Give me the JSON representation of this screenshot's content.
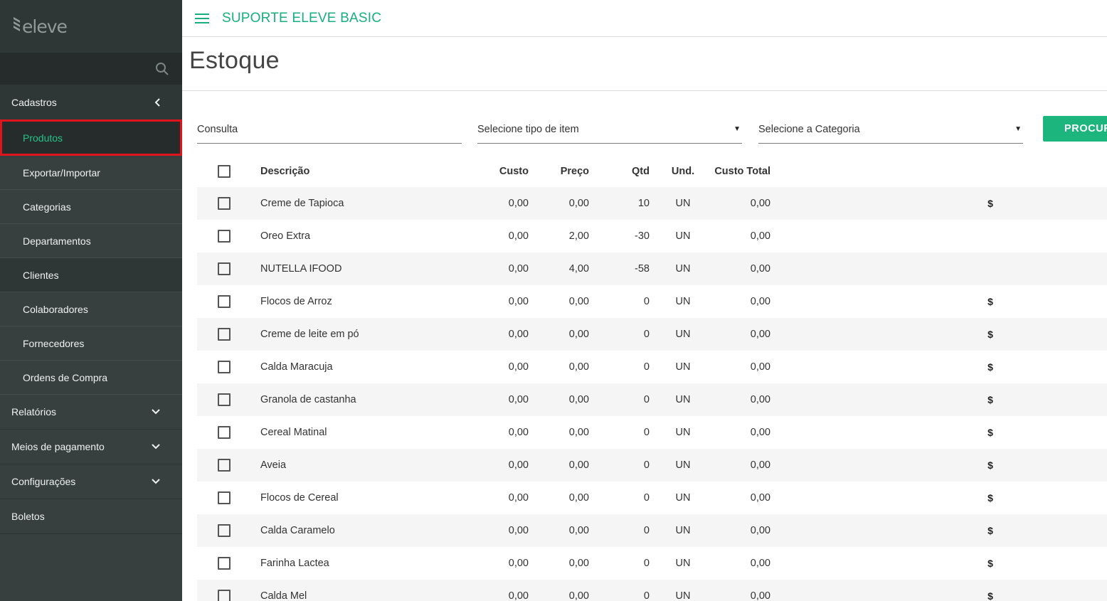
{
  "sidebar": {
    "logo_text": "eleve",
    "groups": {
      "cadastros": "Cadastros",
      "relatorios": "Relatórios",
      "meios": "Meios de pagamento",
      "config": "Configurações",
      "boletos": "Boletos"
    },
    "items": {
      "produtos": "Produtos",
      "exportar": "Exportar/Importar",
      "categorias": "Categorias",
      "departamentos": "Departamentos",
      "clientes": "Clientes",
      "colaboradores": "Colaboradores",
      "fornecedores": "Fornecedores",
      "ordens": "Ordens de Compra"
    }
  },
  "header": {
    "title": "SUPORTE ELEVE BASIC"
  },
  "page": {
    "title": "Estoque"
  },
  "filters": {
    "consulta_placeholder": "Consulta",
    "tipo_item": "Selecione tipo de item",
    "categoria": "Selecione a Categoria",
    "search_button": "PROCUR"
  },
  "table": {
    "headers": {
      "descricao": "Descrição",
      "custo": "Custo",
      "preco": "Preço",
      "qtd": "Qtd",
      "und": "Und.",
      "custo_total": "Custo Total"
    },
    "rows": [
      {
        "descricao": "Creme de Tapioca",
        "custo": "0,00",
        "preco": "0,00",
        "qtd": "10",
        "und": "UN",
        "custo_total": "0,00",
        "action": "$"
      },
      {
        "descricao": "Oreo Extra",
        "custo": "0,00",
        "preco": "2,00",
        "qtd": "-30",
        "und": "UN",
        "custo_total": "0,00",
        "action": ""
      },
      {
        "descricao": "NUTELLA IFOOD",
        "custo": "0,00",
        "preco": "4,00",
        "qtd": "-58",
        "und": "UN",
        "custo_total": "0,00",
        "action": ""
      },
      {
        "descricao": "Flocos de Arroz",
        "custo": "0,00",
        "preco": "0,00",
        "qtd": "0",
        "und": "UN",
        "custo_total": "0,00",
        "action": "$"
      },
      {
        "descricao": "Creme de leite em pó",
        "custo": "0,00",
        "preco": "0,00",
        "qtd": "0",
        "und": "UN",
        "custo_total": "0,00",
        "action": "$"
      },
      {
        "descricao": "Calda Maracuja",
        "custo": "0,00",
        "preco": "0,00",
        "qtd": "0",
        "und": "UN",
        "custo_total": "0,00",
        "action": "$"
      },
      {
        "descricao": "Granola de castanha",
        "custo": "0,00",
        "preco": "0,00",
        "qtd": "0",
        "und": "UN",
        "custo_total": "0,00",
        "action": "$"
      },
      {
        "descricao": "Cereal Matinal",
        "custo": "0,00",
        "preco": "0,00",
        "qtd": "0",
        "und": "UN",
        "custo_total": "0,00",
        "action": "$"
      },
      {
        "descricao": "Aveia",
        "custo": "0,00",
        "preco": "0,00",
        "qtd": "0",
        "und": "UN",
        "custo_total": "0,00",
        "action": "$"
      },
      {
        "descricao": "Flocos de Cereal",
        "custo": "0,00",
        "preco": "0,00",
        "qtd": "0",
        "und": "UN",
        "custo_total": "0,00",
        "action": "$"
      },
      {
        "descricao": "Calda Caramelo",
        "custo": "0,00",
        "preco": "0,00",
        "qtd": "0",
        "und": "UN",
        "custo_total": "0,00",
        "action": "$"
      },
      {
        "descricao": "Farinha Lactea",
        "custo": "0,00",
        "preco": "0,00",
        "qtd": "0",
        "und": "UN",
        "custo_total": "0,00",
        "action": "$"
      },
      {
        "descricao": "Calda Mel",
        "custo": "0,00",
        "preco": "0,00",
        "qtd": "0",
        "und": "UN",
        "custo_total": "0,00",
        "action": "$"
      }
    ]
  },
  "colors": {
    "accent": "#17b07a",
    "sidebar_bg": "#37403f",
    "highlight_border": "#e0141c"
  }
}
